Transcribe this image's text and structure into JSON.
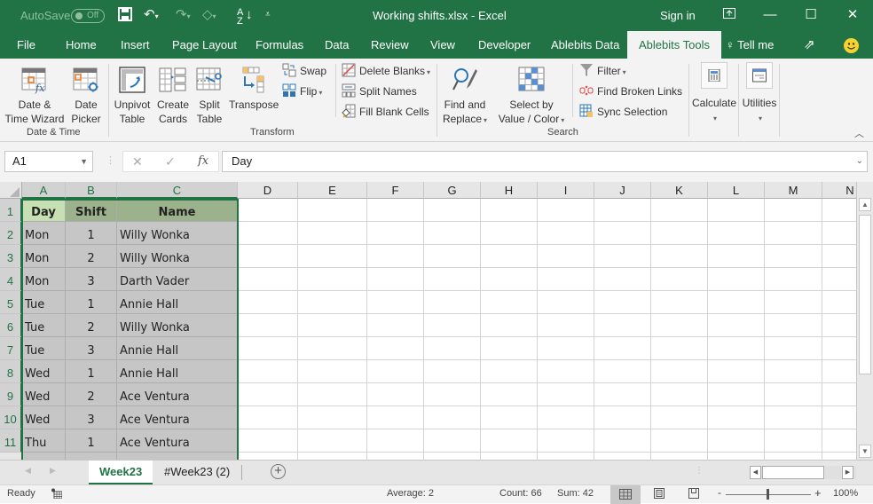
{
  "titlebar": {
    "autosave_label": "AutoSave",
    "autosave_state": "Off",
    "title": "Working shifts.xlsx  -  Excel",
    "sign_in": "Sign in",
    "icons": [
      "save-icon",
      "undo-icon",
      "redo-icon",
      "touch-mode-icon",
      "sort-ascending-icon",
      "customize-qat-icon",
      "ribbon-display-icon",
      "minimize-icon",
      "maximize-icon",
      "close-icon"
    ]
  },
  "menu": {
    "tabs": [
      "File",
      "Home",
      "Insert",
      "Page Layout",
      "Formulas",
      "Data",
      "Review",
      "View",
      "Developer",
      "Ablebits Data",
      "Ablebits Tools",
      "Tell me"
    ],
    "active": "Ablebits Tools"
  },
  "ribbon": {
    "groups": {
      "date_time": {
        "label": "Date & Time",
        "buttons": [
          {
            "line1": "Date &",
            "line2": "Time Wizard"
          },
          {
            "line1": "Date",
            "line2": "Picker"
          }
        ]
      },
      "transform": {
        "label": "Transform",
        "buttons": [
          {
            "line1": "Unpivot",
            "line2": "Table"
          },
          {
            "line1": "Create",
            "line2": "Cards"
          },
          {
            "line1": "Split",
            "line2": "Table"
          },
          {
            "line1": "Transpose",
            "line2": ""
          }
        ],
        "small": [
          "Swap",
          "Flip",
          "Delete Blanks",
          "Split Names",
          "Fill Blank Cells"
        ]
      },
      "search": {
        "label": "Search",
        "buttons": [
          {
            "line1": "Find and",
            "line2": "Replace"
          },
          {
            "line1": "Select by",
            "line2": "Value / Color"
          }
        ],
        "small": [
          "Filter",
          "Find Broken Links",
          "Sync Selection"
        ]
      },
      "calculate": {
        "label": "Calculate"
      },
      "utilities": {
        "label": "Utilities"
      }
    }
  },
  "formula_bar": {
    "name_box": "A1",
    "cancel": "✕",
    "enter": "✓",
    "fx": "fx",
    "content": "Day"
  },
  "sheet": {
    "columns": [
      "A",
      "B",
      "C",
      "D",
      "E",
      "F",
      "G",
      "H",
      "I",
      "J",
      "K",
      "L",
      "M",
      "N"
    ],
    "rows": [
      "1",
      "2",
      "3",
      "4",
      "5",
      "6",
      "7",
      "8",
      "9",
      "10",
      "11"
    ],
    "header": [
      "Day",
      "Shift",
      "Name"
    ],
    "data": [
      [
        "Mon",
        "1",
        "Willy Wonka"
      ],
      [
        "Mon",
        "2",
        "Willy Wonka"
      ],
      [
        "Mon",
        "3",
        "Darth Vader"
      ],
      [
        "Tue",
        "1",
        "Annie Hall"
      ],
      [
        "Tue",
        "2",
        "Willy Wonka"
      ],
      [
        "Tue",
        "3",
        "Annie Hall"
      ],
      [
        "Wed",
        "1",
        "Annie Hall"
      ],
      [
        "Wed",
        "2",
        "Ace Ventura"
      ],
      [
        "Wed",
        "3",
        "Ace Ventura"
      ],
      [
        "Thu",
        "1",
        "Ace Ventura"
      ]
    ]
  },
  "sheet_tabs": [
    "Week23",
    "#Week23 (2)"
  ],
  "active_sheet": "Week23",
  "status": {
    "ready": "Ready",
    "average": "Average: 2",
    "count": "Count: 66",
    "sum": "Sum: 42",
    "zoom": "100%"
  }
}
